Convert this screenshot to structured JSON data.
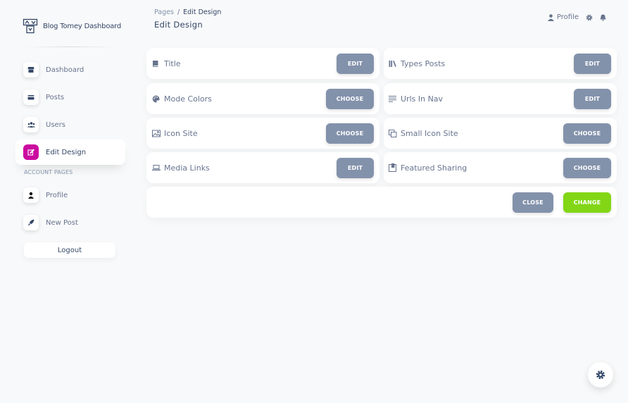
{
  "brand": {
    "name": "Blog Tomey Dashboard"
  },
  "sidebar": {
    "items": [
      {
        "label": "Dashboard",
        "icon": "shop-icon"
      },
      {
        "label": "Posts",
        "icon": "credit-card-icon"
      },
      {
        "label": "Users",
        "icon": "users-icon"
      },
      {
        "label": "Edit Design",
        "icon": "edit-icon",
        "active": true
      }
    ],
    "section_title": "ACCOUNT PAGES",
    "account_items": [
      {
        "label": "Profile",
        "icon": "user-icon"
      },
      {
        "label": "New Post",
        "icon": "rocket-icon"
      }
    ],
    "logout_label": "Logout"
  },
  "header": {
    "breadcrumb": {
      "root": "Pages",
      "separator": "/",
      "current": "Edit Design"
    },
    "title": "Edit Design",
    "profile_label": "Profile"
  },
  "settings": [
    {
      "label": "Title",
      "icon": "book-icon",
      "button": "EDIT"
    },
    {
      "label": "Types Posts",
      "icon": "library-icon",
      "button": "EDIT"
    },
    {
      "label": "Mode Colors",
      "icon": "palette-icon",
      "button": "CHOOSE"
    },
    {
      "label": "Urls In Nav",
      "icon": "text-lines-icon",
      "button": "EDIT"
    },
    {
      "label": "Icon Site",
      "icon": "image-icon",
      "button": "CHOOSE"
    },
    {
      "label": "Small Icon Site",
      "icon": "copy-icon",
      "button": "CHOOSE"
    },
    {
      "label": "Media Links",
      "icon": "laptop-icon",
      "button": "EDIT"
    },
    {
      "label": "Featured Sharing",
      "icon": "share-board-icon",
      "button": "CHOOSE"
    }
  ],
  "actions": {
    "close_label": "CLOSE",
    "change_label": "CHANGE"
  },
  "colors": {
    "accent": "#cb0c9f",
    "button_secondary": "#8392ab",
    "button_success": "#82d616",
    "text_dark": "#344767",
    "text_muted": "#67748e"
  }
}
